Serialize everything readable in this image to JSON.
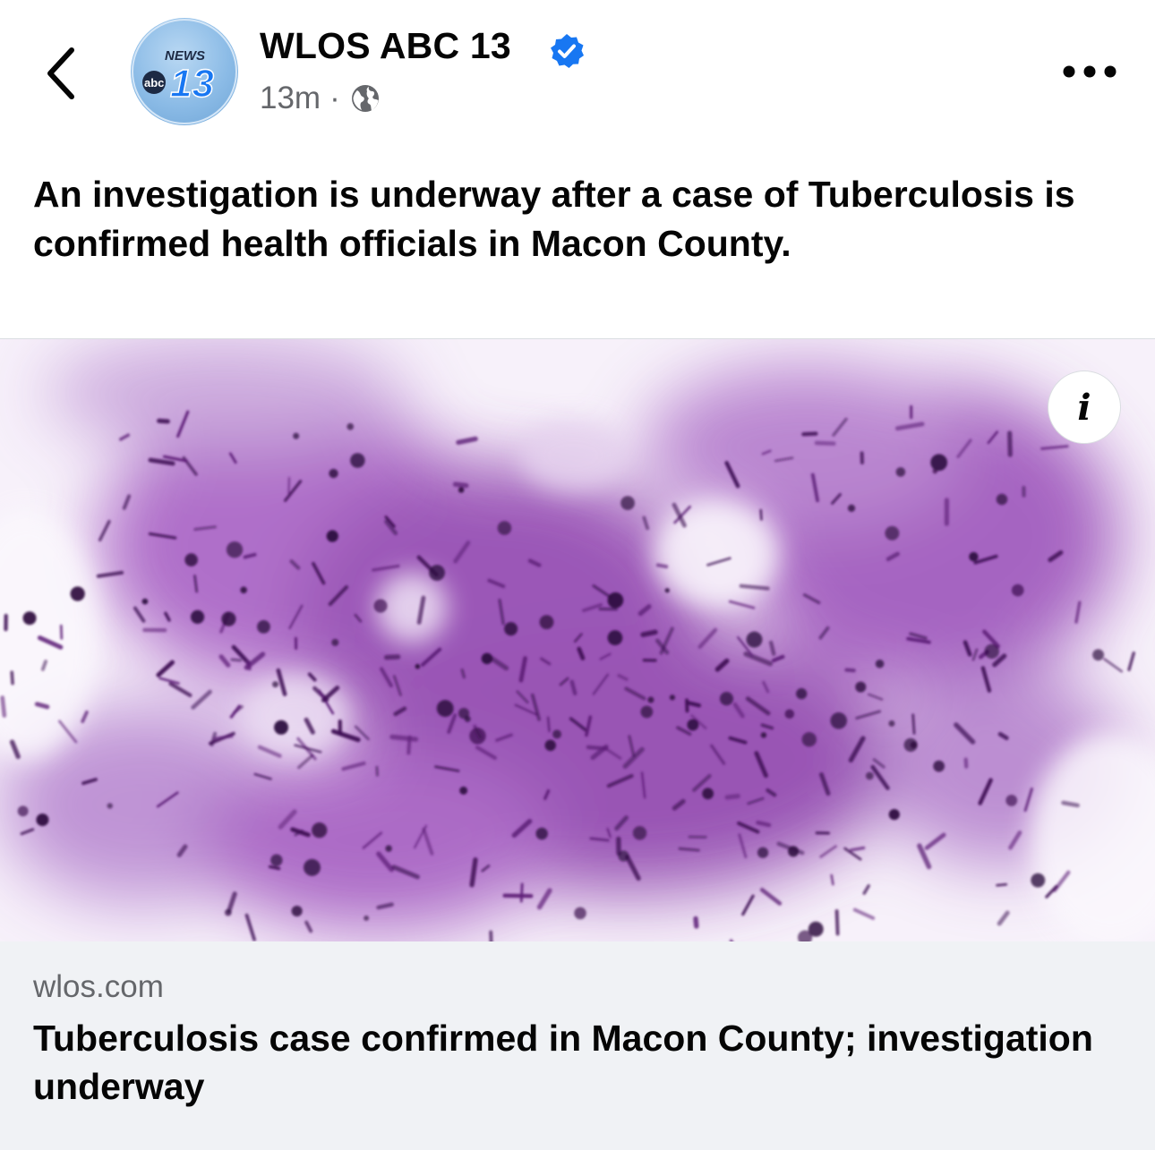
{
  "header": {
    "page_name": "WLOS ABC 13",
    "timestamp": "13m",
    "separator": "·",
    "privacy_icon": "globe-icon",
    "verified_icon": "verified-badge-icon",
    "back_icon": "chevron-left-icon",
    "more_icon": "more-dots-icon",
    "avatar": {
      "logo_top_text": "NEWS",
      "logo_network": "abc",
      "logo_number": "13"
    }
  },
  "post": {
    "text": "An investigation is underway after a case of Tuberculosis is confirmed health officials in Macon County."
  },
  "media": {
    "info_label": "i",
    "info_icon": "info-icon"
  },
  "link": {
    "domain": "wlos.com",
    "title": "Tuberculosis case confirmed in Macon County; investigation underway"
  },
  "colors": {
    "verified_blue": "#1877f2",
    "secondary_text": "#65676b",
    "link_card_bg": "#f0f2f5",
    "stain_purple": "#9a4fb8",
    "avatar_blue": "#8bbbe6"
  }
}
